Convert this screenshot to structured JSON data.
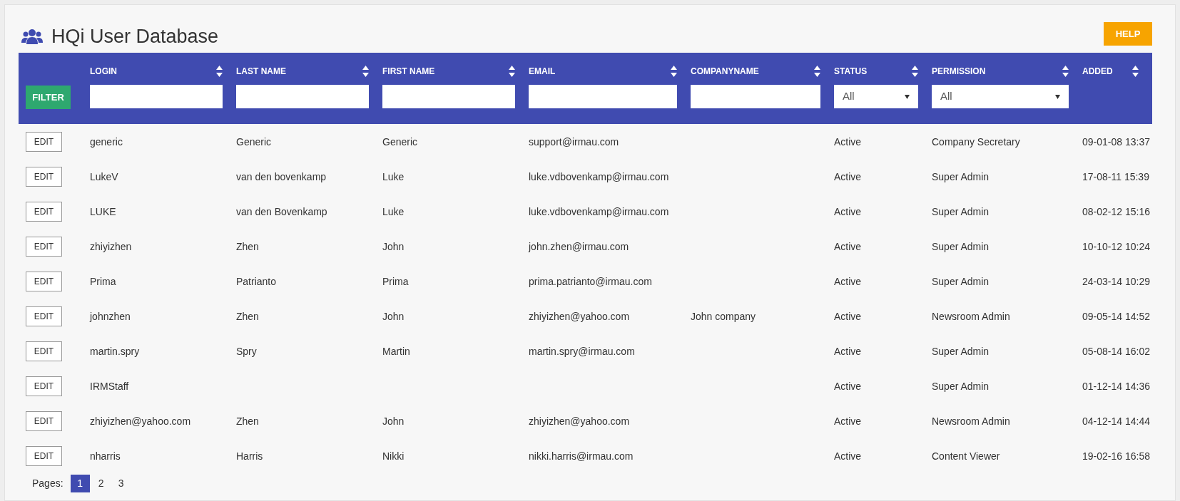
{
  "title": "HQi User Database",
  "help_button": "HELP",
  "filter_button": "FILTER",
  "columns": [
    {
      "label": "LOGIN",
      "filter": {
        "kind": "text"
      }
    },
    {
      "label": "LAST NAME",
      "filter": {
        "kind": "text"
      }
    },
    {
      "label": "FIRST NAME",
      "filter": {
        "kind": "text"
      }
    },
    {
      "label": "EMAIL",
      "filter": {
        "kind": "text"
      }
    },
    {
      "label": "COMPANYNAME",
      "filter": {
        "kind": "text"
      }
    },
    {
      "label": "STATUS",
      "filter": {
        "kind": "select",
        "value": "All"
      }
    },
    {
      "label": "PERMISSION",
      "filter": {
        "kind": "select",
        "value": "All"
      }
    },
    {
      "label": "ADDED",
      "filter": {
        "kind": "none"
      }
    }
  ],
  "rows": [
    {
      "edit": "EDIT",
      "cells": [
        "generic",
        "Generic",
        "Generic",
        "support@irmau.com",
        null,
        "Active",
        "Company Secretary",
        "09-01-08 13:37"
      ]
    },
    {
      "edit": "EDIT",
      "cells": [
        "LukeV",
        "van den bovenkamp",
        "Luke",
        "luke.vdbovenkamp@irmau.com",
        null,
        "Active",
        "Super Admin",
        "17-08-11 15:39"
      ]
    },
    {
      "edit": "EDIT",
      "cells": [
        "LUKE",
        "van den Bovenkamp",
        "Luke",
        "luke.vdbovenkamp@irmau.com",
        null,
        "Active",
        "Super Admin",
        "08-02-12 15:16"
      ]
    },
    {
      "edit": "EDIT",
      "cells": [
        "zhiyizhen",
        "Zhen",
        "John",
        "john.zhen@irmau.com",
        null,
        "Active",
        "Super Admin",
        "10-10-12 10:24"
      ]
    },
    {
      "edit": "EDIT",
      "cells": [
        "Prima",
        "Patrianto",
        "Prima",
        "prima.patrianto@irmau.com",
        null,
        "Active",
        "Super Admin",
        "24-03-14 10:29"
      ]
    },
    {
      "edit": "EDIT",
      "cells": [
        "johnzhen",
        "Zhen",
        "John",
        "zhiyizhen@yahoo.com",
        "John company",
        "Active",
        "Newsroom Admin",
        "09-05-14 14:52"
      ]
    },
    {
      "edit": "EDIT",
      "cells": [
        "martin.spry",
        "Spry",
        "Martin",
        "martin.spry@irmau.com",
        null,
        "Active",
        "Super Admin",
        "05-08-14 16:02"
      ]
    },
    {
      "edit": "EDIT",
      "cells": [
        "IRMStaff",
        null,
        null,
        null,
        null,
        "Active",
        "Super Admin",
        "01-12-14 14:36"
      ]
    },
    {
      "edit": "EDIT",
      "cells": [
        "zhiyizhen@yahoo.com",
        "Zhen",
        "John",
        "zhiyizhen@yahoo.com",
        null,
        "Active",
        "Newsroom Admin",
        "04-12-14 14:44"
      ]
    },
    {
      "edit": "EDIT",
      "cells": [
        "nharris",
        "Harris",
        "Nikki",
        "nikki.harris@irmau.com",
        null,
        "Active",
        "Content Viewer",
        "19-02-16 16:58"
      ]
    }
  ],
  "pagination": {
    "label": "Pages:",
    "pages": [
      {
        "label": "1",
        "selected": true
      },
      {
        "label": "2",
        "selected": false
      },
      {
        "label": "3",
        "selected": false
      }
    ]
  }
}
